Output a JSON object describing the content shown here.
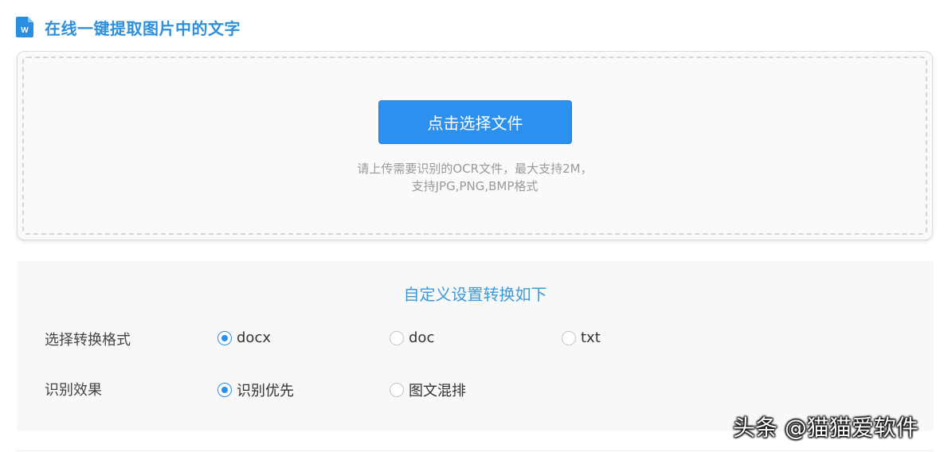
{
  "header": {
    "icon": "word-document-icon",
    "icon_letter": "W",
    "title": "在线一键提取图片中的文字"
  },
  "upload": {
    "button_label": "点击选择文件",
    "hint_line1": "请上传需要识别的OCR文件，最大支持2M，",
    "hint_line2": "支持JPG,PNG,BMP格式"
  },
  "settings": {
    "title": "自定义设置转换如下",
    "format": {
      "label": "选择转换格式",
      "options": [
        "docx",
        "doc",
        "txt"
      ],
      "selected": "docx"
    },
    "effect": {
      "label": "识别效果",
      "options": [
        "识别优先",
        "图文混排"
      ],
      "selected": "识别优先"
    }
  },
  "watermark": "头条 @猫猫爱软件",
  "colors": {
    "accent": "#2b90ee",
    "title": "#2d8fdd",
    "settings_title": "#3c9ad8"
  }
}
